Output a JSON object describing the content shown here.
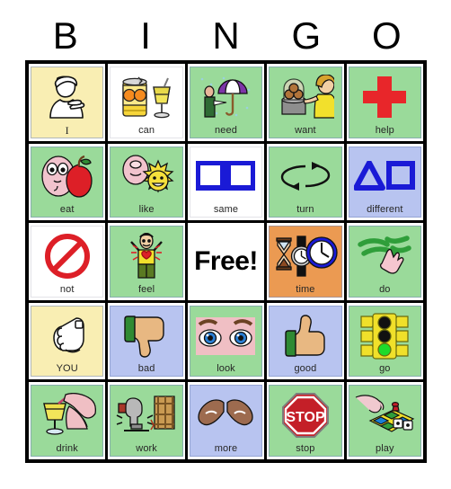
{
  "header": {
    "letters": [
      "B",
      "I",
      "N",
      "G",
      "O"
    ]
  },
  "free_space": {
    "label": "Free!"
  },
  "colors": {
    "yellow": "#f9eeb3",
    "green": "#9ada9a",
    "periwinkle": "#b8c4f0",
    "orange": "#eb9a52",
    "white": "#ffffff",
    "border": "#000000",
    "label_text": "#262626",
    "red": "#e8262a",
    "blue": "#1a1ad6"
  },
  "grid": {
    "rows": [
      [
        {
          "label": "I",
          "bg": "yellow",
          "icon": "person-pointing-self-icon",
          "label_font": "serif"
        },
        {
          "label": "can",
          "bg": "white",
          "icon": "can-and-glass-icon"
        },
        {
          "label": "need",
          "bg": "green",
          "icon": "umbrella-rain-icon"
        },
        {
          "label": "want",
          "bg": "green",
          "icon": "person-reaching-cookies-icon"
        },
        {
          "label": "help",
          "bg": "green",
          "icon": "red-cross-icon"
        }
      ],
      [
        {
          "label": "eat",
          "bg": "green",
          "icon": "face-eating-apple-icon"
        },
        {
          "label": "like",
          "bg": "green",
          "icon": "face-sun-icon"
        },
        {
          "label": "same",
          "bg": "white",
          "icon": "two-squares-icon"
        },
        {
          "label": "turn",
          "bg": "green",
          "icon": "circular-arrows-icon"
        },
        {
          "label": "different",
          "bg": "periwinkle",
          "icon": "triangle-square-icon"
        }
      ],
      [
        {
          "label": "not",
          "bg": "white",
          "icon": "prohibition-sign-icon"
        },
        {
          "label": "feel",
          "bg": "green",
          "icon": "person-feeling-heart-icon"
        },
        {
          "label": "Free!",
          "bg": "white",
          "icon": "free-space",
          "free": true
        },
        {
          "label": "time",
          "bg": "orange",
          "icon": "hourglass-watch-clock-icon"
        },
        {
          "label": "do",
          "bg": "green",
          "icon": "hand-scribble-icon"
        }
      ],
      [
        {
          "label": "YOU",
          "bg": "yellow",
          "icon": "pointing-hand-icon"
        },
        {
          "label": "bad",
          "bg": "periwinkle",
          "icon": "thumbs-down-icon"
        },
        {
          "label": "look",
          "bg": "green",
          "icon": "eyes-icon"
        },
        {
          "label": "good",
          "bg": "periwinkle",
          "icon": "thumbs-up-icon"
        },
        {
          "label": "go",
          "bg": "green",
          "icon": "traffic-light-green-icon"
        }
      ],
      [
        {
          "label": "drink",
          "bg": "green",
          "icon": "hand-glass-straw-icon"
        },
        {
          "label": "work",
          "bg": "green",
          "icon": "hammer-construction-icon"
        },
        {
          "label": "more",
          "bg": "periwinkle",
          "icon": "two-hands-together-icon"
        },
        {
          "label": "stop",
          "bg": "green",
          "icon": "stop-sign-icon"
        },
        {
          "label": "play",
          "bg": "green",
          "icon": "board-game-hand-icon"
        }
      ]
    ]
  }
}
